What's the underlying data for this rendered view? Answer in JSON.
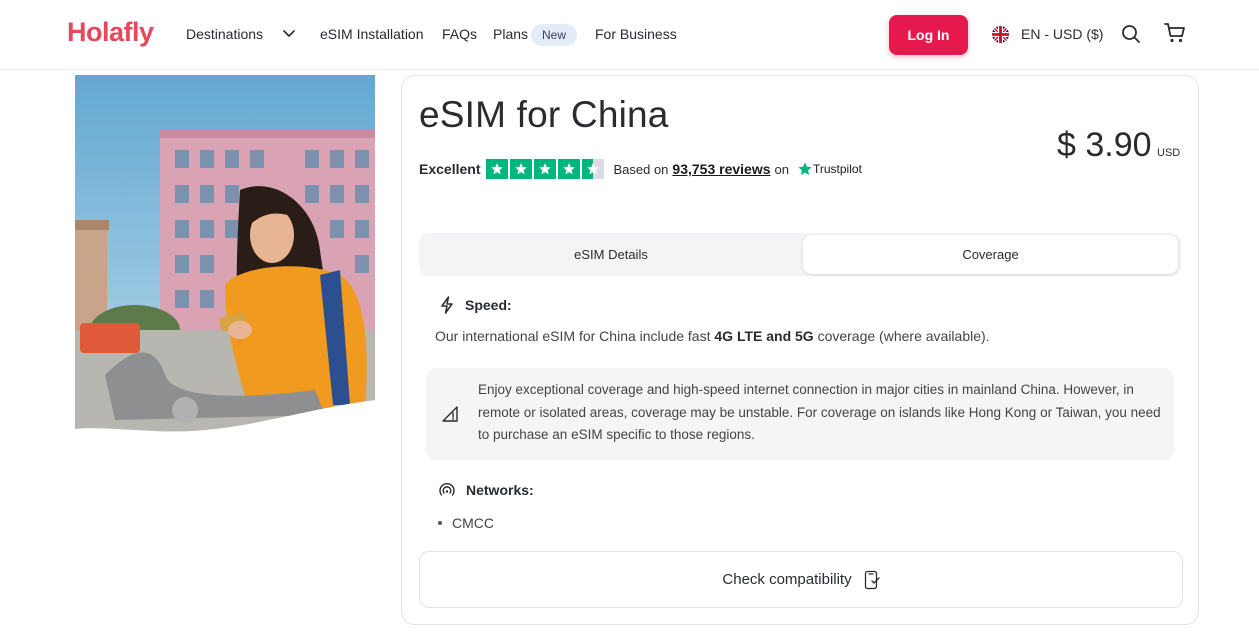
{
  "header": {
    "logo": "Holafly",
    "nav": {
      "destinations": "Destinations",
      "esim_installation": "eSIM Installation",
      "faqs": "FAQs",
      "plans": "Plans",
      "plans_badge": "New",
      "for_business": "For Business"
    },
    "login_label": "Log In",
    "language": "EN - USD ($)",
    "icons": [
      "chevron-down-icon",
      "uk-flag-icon",
      "search-icon",
      "cart-icon"
    ]
  },
  "product": {
    "title": "eSIM for China",
    "price": "$ 3.90",
    "currency": "USD",
    "rating": {
      "label": "Excellent",
      "stars": 4.5,
      "based_on": "Based on",
      "reviews_link": "93,753 reviews",
      "on": "on",
      "provider": "Trustpilot"
    },
    "tabs": [
      {
        "label": "eSIM Details",
        "active": false
      },
      {
        "label": "Coverage",
        "active": true
      }
    ],
    "speed": {
      "heading": "Speed:",
      "text_before": "Our international eSIM for China include fast ",
      "text_bold": "4G LTE and 5G",
      "text_after": " coverage (where available)."
    },
    "coverage_note": "Enjoy exceptional coverage and high-speed internet connection in major cities in mainland China. However, in remote or isolated areas, coverage may be unstable. For coverage on islands like Hong Kong or Taiwan, you need to purchase an eSIM specific to those regions.",
    "networks": {
      "heading": "Networks:",
      "items": [
        "CMCC"
      ]
    },
    "check_compatibility": "Check compatibility"
  },
  "colors": {
    "brand": "#e6485c",
    "login_button": "#e6194f",
    "trustpilot_green": "#00b67a",
    "badge_bg": "#e4ecfa"
  }
}
